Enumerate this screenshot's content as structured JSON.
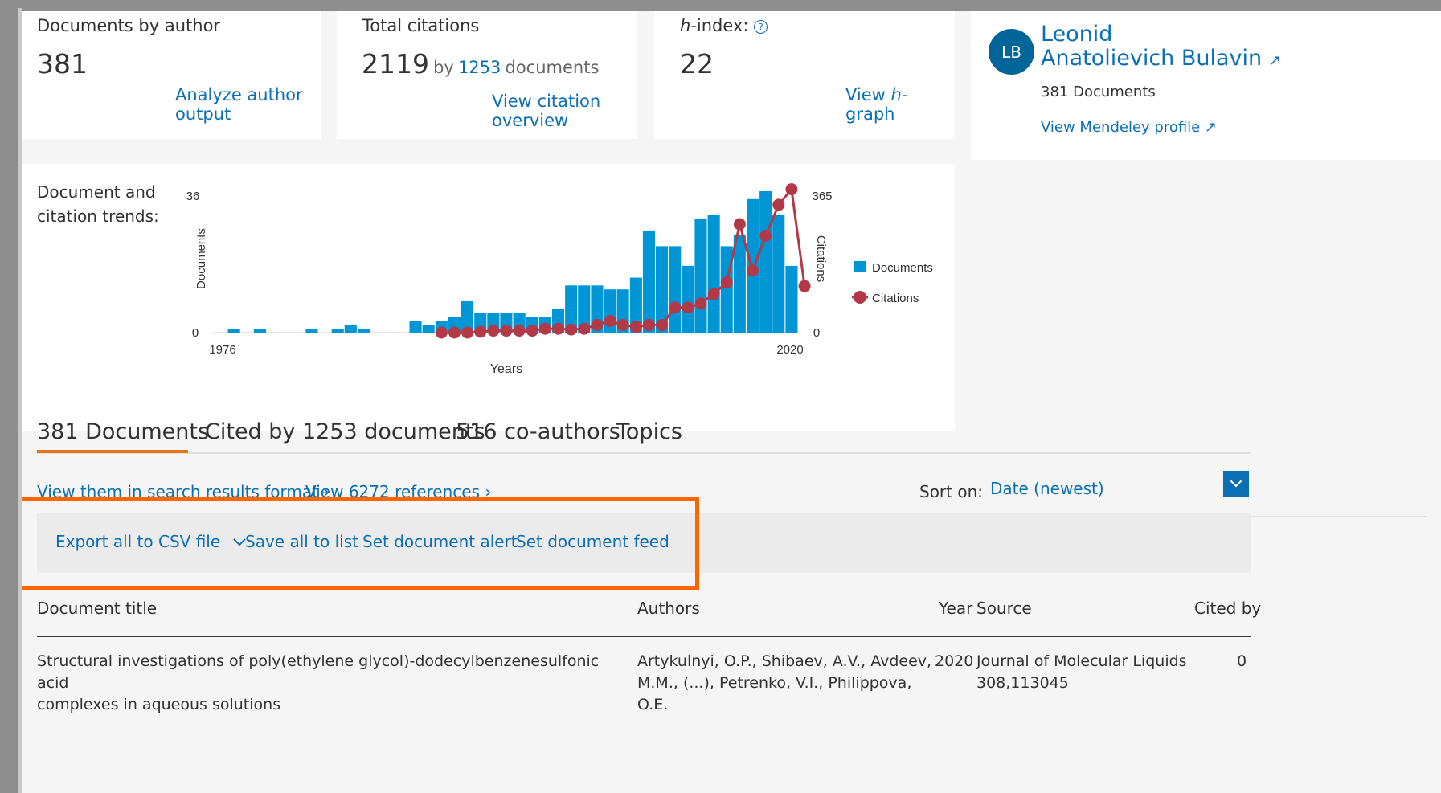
{
  "metrics": {
    "documents": {
      "label": "Documents by author",
      "value": "381",
      "link": "Analyze author output"
    },
    "citations": {
      "label": "Total citations",
      "value": "2119",
      "by": "by",
      "by_count": "1253",
      "by_suffix": "documents",
      "link": "View citation overview"
    },
    "hindex": {
      "label_italic": "h",
      "label_rest": "-index:",
      "help_icon": "?",
      "value": "22",
      "link_prefix": "View",
      "link_italic": "h",
      "link_suffix": "-graph"
    }
  },
  "profile": {
    "initials": "LB",
    "name_line1": "Leonid",
    "name_line2": "Anatolievich Bulavin",
    "external_icon": "↗",
    "documents": "381 Documents",
    "mendeley_link": "View Mendeley profile"
  },
  "chart_data": {
    "type": "bar+line",
    "title_line1": "Document and",
    "title_line2": "citation trends:",
    "xlabel": "Years",
    "ylabel_left": "Documents",
    "ylabel_right": "Citations",
    "x_start_label": "1976",
    "x_end_label": "2020",
    "y_left_max": "36",
    "y_left_min": "0",
    "y_right_max": "365",
    "y_right_min": "0",
    "ylim_left": [
      0,
      36
    ],
    "ylim_right": [
      0,
      365
    ],
    "years": [
      1976,
      1977,
      1978,
      1979,
      1980,
      1981,
      1982,
      1983,
      1984,
      1985,
      1986,
      1987,
      1988,
      1989,
      1990,
      1991,
      1992,
      1993,
      1994,
      1995,
      1996,
      1997,
      1998,
      1999,
      2000,
      2001,
      2002,
      2003,
      2004,
      2005,
      2006,
      2007,
      2008,
      2009,
      2010,
      2011,
      2012,
      2013,
      2014,
      2015,
      2016,
      2017,
      2018,
      2019,
      2020
    ],
    "series": [
      {
        "name": "Documents",
        "color": "#0096d6",
        "values": [
          0,
          1,
          0,
          1,
          0,
          0,
          0,
          1,
          0,
          1,
          2,
          1,
          0,
          0,
          0,
          3,
          2,
          3,
          4,
          8,
          5,
          5,
          5,
          5,
          4,
          4,
          6,
          12,
          12,
          12,
          11,
          11,
          14,
          26,
          22,
          22,
          17,
          29,
          30,
          22,
          25,
          34,
          36,
          30,
          17
        ]
      },
      {
        "name": "Citations",
        "color": "#b23a48",
        "start_year": 1993,
        "values": [
          0,
          0,
          0,
          2,
          5,
          5,
          5,
          5,
          10,
          10,
          8,
          10,
          20,
          30,
          20,
          15,
          20,
          20,
          65,
          65,
          75,
          100,
          130,
          280,
          160,
          250,
          330,
          370,
          120
        ]
      }
    ],
    "legend_position": "right"
  },
  "tabs": [
    {
      "label": "381 Documents",
      "active": true
    },
    {
      "label": "Cited by 1253 documents",
      "active": false
    },
    {
      "label": "516 co-authors",
      "active": false
    },
    {
      "label": "Topics",
      "active": false
    }
  ],
  "links": {
    "search_format": "View them in search results format",
    "references": "View 6272 references",
    "chevron": "›"
  },
  "sort": {
    "label": "Sort on:",
    "value": "Date (newest)"
  },
  "actions": {
    "export": "Export all to CSV file",
    "save": "Save all to list",
    "alert": "Set document alert",
    "feed": "Set document feed"
  },
  "table": {
    "headers": {
      "title": "Document title",
      "authors": "Authors",
      "year": "Year",
      "source": "Source",
      "cited": "Cited by"
    },
    "rows": [
      {
        "title_line1": "Structural investigations of poly(ethylene glycol)-dodecylbenzenesulfonic acid",
        "title_line2": "complexes in aqueous solutions",
        "authors_line1": "Artykulnyi, O.P., Shibaev, A.V., Avdeev,",
        "authors_line2": "M.M., (...), Petrenko, V.I., Philippova, O.E.",
        "year": "2020",
        "source_line1": "Journal of Molecular Liquids",
        "source_line2": "308,113045",
        "cited": "0"
      }
    ]
  }
}
